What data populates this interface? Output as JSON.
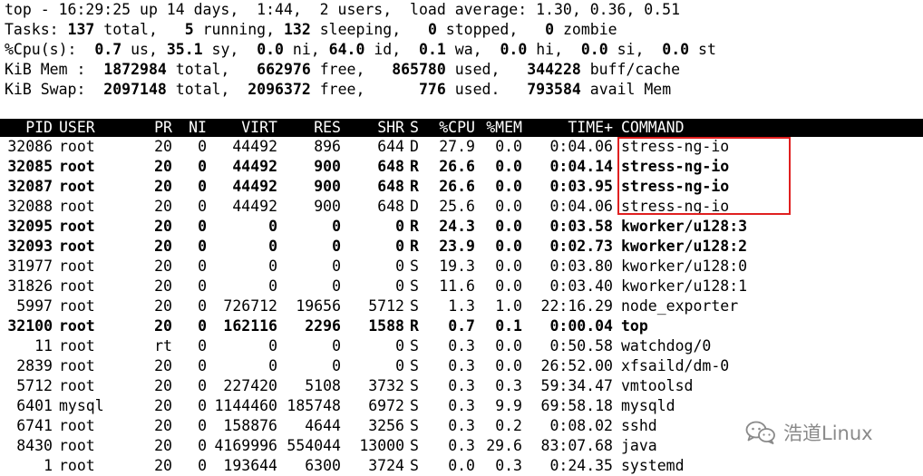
{
  "summary": [
    {
      "segments": [
        {
          "t": "top - 16:29:25 up 14 days,  1:44,  2 users,  load average: 1.30, 0.36, 0.51",
          "b": false
        }
      ]
    },
    {
      "segments": [
        {
          "t": "Tasks: ",
          "b": false
        },
        {
          "t": "137",
          "b": true
        },
        {
          "t": " total,   ",
          "b": false
        },
        {
          "t": "5",
          "b": true
        },
        {
          "t": " running, ",
          "b": false
        },
        {
          "t": "132",
          "b": true
        },
        {
          "t": " sleeping,   ",
          "b": false
        },
        {
          "t": "0",
          "b": true
        },
        {
          "t": " stopped,   ",
          "b": false
        },
        {
          "t": "0",
          "b": true
        },
        {
          "t": " zombie",
          "b": false
        }
      ]
    },
    {
      "segments": [
        {
          "t": "%Cpu(s):  ",
          "b": false
        },
        {
          "t": "0.7",
          "b": true
        },
        {
          "t": " us, ",
          "b": false
        },
        {
          "t": "35.1",
          "b": true
        },
        {
          "t": " sy,  ",
          "b": false
        },
        {
          "t": "0.0",
          "b": true
        },
        {
          "t": " ni, ",
          "b": false
        },
        {
          "t": "64.0",
          "b": true
        },
        {
          "t": " id,  ",
          "b": false
        },
        {
          "t": "0.1",
          "b": true
        },
        {
          "t": " wa,  ",
          "b": false
        },
        {
          "t": "0.0",
          "b": true
        },
        {
          "t": " hi,  ",
          "b": false
        },
        {
          "t": "0.0",
          "b": true
        },
        {
          "t": " si,  ",
          "b": false
        },
        {
          "t": "0.0",
          "b": true
        },
        {
          "t": " st",
          "b": false
        }
      ]
    },
    {
      "segments": [
        {
          "t": "KiB Mem :  ",
          "b": false
        },
        {
          "t": "1872984",
          "b": true
        },
        {
          "t": " total,   ",
          "b": false
        },
        {
          "t": "662976",
          "b": true
        },
        {
          "t": " free,   ",
          "b": false
        },
        {
          "t": "865780",
          "b": true
        },
        {
          "t": " used,   ",
          "b": false
        },
        {
          "t": "344228",
          "b": true
        },
        {
          "t": " buff/cache",
          "b": false
        }
      ]
    },
    {
      "segments": [
        {
          "t": "KiB Swap:  ",
          "b": false
        },
        {
          "t": "2097148",
          "b": true
        },
        {
          "t": " total,  ",
          "b": false
        },
        {
          "t": "2096372",
          "b": true
        },
        {
          "t": " free,      ",
          "b": false
        },
        {
          "t": "776",
          "b": true
        },
        {
          "t": " used.   ",
          "b": false
        },
        {
          "t": "793584",
          "b": true
        },
        {
          "t": " avail Mem",
          "b": false
        }
      ]
    }
  ],
  "columns": {
    "pid": "PID",
    "user": "USER",
    "pr": "PR",
    "ni": "NI",
    "virt": "VIRT",
    "res": "RES",
    "shr": "SHR",
    "s": "S",
    "cpu": "%CPU",
    "mem": "%MEM",
    "time": "TIME+",
    "cmd": "COMMAND"
  },
  "processes": [
    {
      "pid": "32086",
      "user": "root",
      "pr": "20",
      "ni": "0",
      "virt": "44492",
      "res": "896",
      "shr": "644",
      "s": "D",
      "cpu": "27.9",
      "mem": "0.0",
      "time": "0:04.06",
      "cmd": "stress-ng-io",
      "bold": false
    },
    {
      "pid": "32085",
      "user": "root",
      "pr": "20",
      "ni": "0",
      "virt": "44492",
      "res": "900",
      "shr": "648",
      "s": "R",
      "cpu": "26.6",
      "mem": "0.0",
      "time": "0:04.14",
      "cmd": "stress-ng-io",
      "bold": true
    },
    {
      "pid": "32087",
      "user": "root",
      "pr": "20",
      "ni": "0",
      "virt": "44492",
      "res": "900",
      "shr": "648",
      "s": "R",
      "cpu": "26.6",
      "mem": "0.0",
      "time": "0:03.95",
      "cmd": "stress-ng-io",
      "bold": true
    },
    {
      "pid": "32088",
      "user": "root",
      "pr": "20",
      "ni": "0",
      "virt": "44492",
      "res": "900",
      "shr": "648",
      "s": "D",
      "cpu": "25.6",
      "mem": "0.0",
      "time": "0:04.06",
      "cmd": "stress-ng-io",
      "bold": false
    },
    {
      "pid": "32095",
      "user": "root",
      "pr": "20",
      "ni": "0",
      "virt": "0",
      "res": "0",
      "shr": "0",
      "s": "R",
      "cpu": "24.3",
      "mem": "0.0",
      "time": "0:03.58",
      "cmd": "kworker/u128:3",
      "bold": true
    },
    {
      "pid": "32093",
      "user": "root",
      "pr": "20",
      "ni": "0",
      "virt": "0",
      "res": "0",
      "shr": "0",
      "s": "R",
      "cpu": "23.9",
      "mem": "0.0",
      "time": "0:02.73",
      "cmd": "kworker/u128:2",
      "bold": true
    },
    {
      "pid": "31977",
      "user": "root",
      "pr": "20",
      "ni": "0",
      "virt": "0",
      "res": "0",
      "shr": "0",
      "s": "S",
      "cpu": "19.3",
      "mem": "0.0",
      "time": "0:03.80",
      "cmd": "kworker/u128:0",
      "bold": false
    },
    {
      "pid": "31826",
      "user": "root",
      "pr": "20",
      "ni": "0",
      "virt": "0",
      "res": "0",
      "shr": "0",
      "s": "S",
      "cpu": "11.6",
      "mem": "0.0",
      "time": "0:03.40",
      "cmd": "kworker/u128:1",
      "bold": false
    },
    {
      "pid": "5997",
      "user": "root",
      "pr": "20",
      "ni": "0",
      "virt": "726712",
      "res": "19656",
      "shr": "5712",
      "s": "S",
      "cpu": "1.3",
      "mem": "1.0",
      "time": "22:16.29",
      "cmd": "node_exporter",
      "bold": false
    },
    {
      "pid": "32100",
      "user": "root",
      "pr": "20",
      "ni": "0",
      "virt": "162116",
      "res": "2296",
      "shr": "1588",
      "s": "R",
      "cpu": "0.7",
      "mem": "0.1",
      "time": "0:00.04",
      "cmd": "top",
      "bold": true
    },
    {
      "pid": "11",
      "user": "root",
      "pr": "rt",
      "ni": "0",
      "virt": "0",
      "res": "0",
      "shr": "0",
      "s": "S",
      "cpu": "0.3",
      "mem": "0.0",
      "time": "0:50.58",
      "cmd": "watchdog/0",
      "bold": false
    },
    {
      "pid": "2839",
      "user": "root",
      "pr": "20",
      "ni": "0",
      "virt": "0",
      "res": "0",
      "shr": "0",
      "s": "S",
      "cpu": "0.3",
      "mem": "0.0",
      "time": "26:52.00",
      "cmd": "xfsaild/dm-0",
      "bold": false
    },
    {
      "pid": "5712",
      "user": "root",
      "pr": "20",
      "ni": "0",
      "virt": "227420",
      "res": "5108",
      "shr": "3732",
      "s": "S",
      "cpu": "0.3",
      "mem": "0.3",
      "time": "59:34.47",
      "cmd": "vmtoolsd",
      "bold": false
    },
    {
      "pid": "6401",
      "user": "mysql",
      "pr": "20",
      "ni": "0",
      "virt": "1144460",
      "res": "185748",
      "shr": "6972",
      "s": "S",
      "cpu": "0.3",
      "mem": "9.9",
      "time": "69:58.18",
      "cmd": "mysqld",
      "bold": false
    },
    {
      "pid": "6741",
      "user": "root",
      "pr": "20",
      "ni": "0",
      "virt": "158876",
      "res": "4644",
      "shr": "3256",
      "s": "S",
      "cpu": "0.3",
      "mem": "0.2",
      "time": "0:08.02",
      "cmd": "sshd",
      "bold": false
    },
    {
      "pid": "8430",
      "user": "root",
      "pr": "20",
      "ni": "0",
      "virt": "4169996",
      "res": "554044",
      "shr": "13000",
      "s": "S",
      "cpu": "0.3",
      "mem": "29.6",
      "time": "83:07.68",
      "cmd": "java",
      "bold": false
    },
    {
      "pid": "1",
      "user": "root",
      "pr": "20",
      "ni": "0",
      "virt": "193644",
      "res": "6300",
      "shr": "3724",
      "s": "S",
      "cpu": "0.0",
      "mem": "0.3",
      "time": "0:24.35",
      "cmd": "systemd",
      "bold": false
    }
  ],
  "highlight": {
    "color": "#e02020",
    "rows": [
      "32086",
      "32085",
      "32087",
      "32088"
    ]
  },
  "watermark": {
    "icon": "wechat-icon",
    "text": "浩道Linux"
  }
}
